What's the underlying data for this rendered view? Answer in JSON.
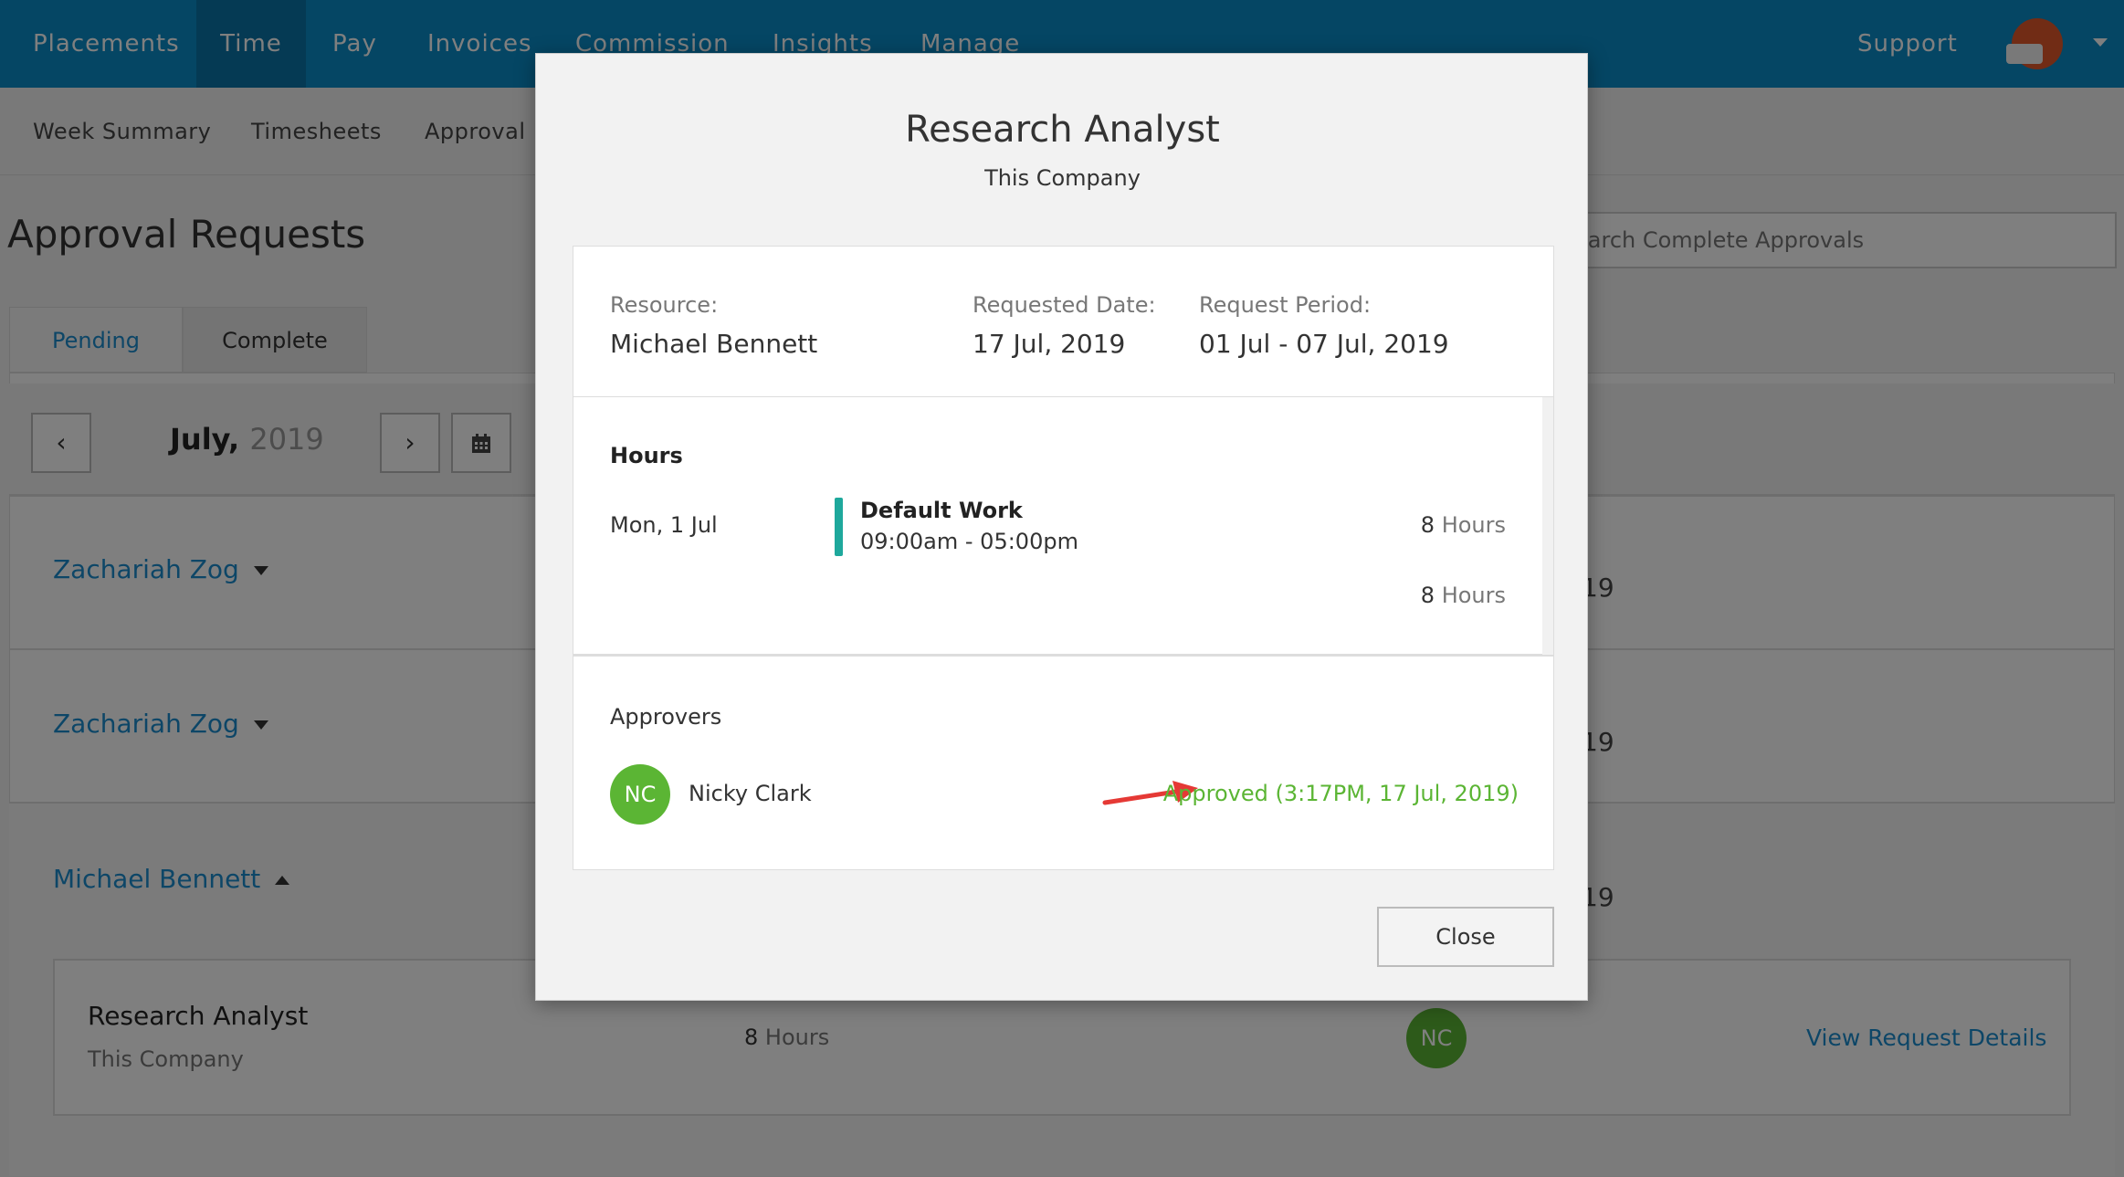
{
  "topnav": {
    "items": [
      "Placements",
      "Time",
      "Pay",
      "Invoices",
      "Commission",
      "Insights",
      "Manage"
    ],
    "support": "Support"
  },
  "subnav": {
    "items": [
      "Week Summary",
      "Timesheets",
      "Approval R"
    ]
  },
  "page": {
    "title": "Approval Requests",
    "search_placeholder": "earch Complete Approvals",
    "tabs": [
      "Pending",
      "Complete"
    ],
    "month": "July,",
    "year": "2019",
    "rows": [
      {
        "name": "Zachariah Zog",
        "year_frag": "19"
      },
      {
        "name": "Zachariah Zog",
        "year_frag": "19"
      },
      {
        "name": "Michael Bennett",
        "year_frag": "19"
      }
    ],
    "detail": {
      "title": "Research Analyst",
      "company": "This Company",
      "hours_num": "8",
      "hours_unit": "Hours",
      "approver_initials": "NC",
      "link": "View Request Details"
    }
  },
  "modal": {
    "title": "Research Analyst",
    "company": "This Company",
    "resource_label": "Resource:",
    "resource_value": "Michael Bennett",
    "requested_label": "Requested Date:",
    "requested_value": "17 Jul, 2019",
    "period_label": "Request Period:",
    "period_value": "01 Jul - 07 Jul, 2019",
    "hours_heading": "Hours",
    "entry_day": "Mon, 1 Jul",
    "entry_work": "Default Work",
    "entry_time": "09:00am - 05:00pm",
    "entry_hours": "8",
    "total_hours": "8",
    "hours_unit": "Hours",
    "approvers_heading": "Approvers",
    "approver_initials": "NC",
    "approver_name": "Nicky Clark",
    "approver_status": "Approved (3:17PM, 17 Jul, 2019)",
    "close_label": "Close"
  },
  "colors": {
    "nav_blue": "#0a8cc8",
    "link_blue": "#1a8ccf",
    "approved_green": "#5bb534",
    "teal": "#1ea89c",
    "arrow_red": "#e53935"
  }
}
